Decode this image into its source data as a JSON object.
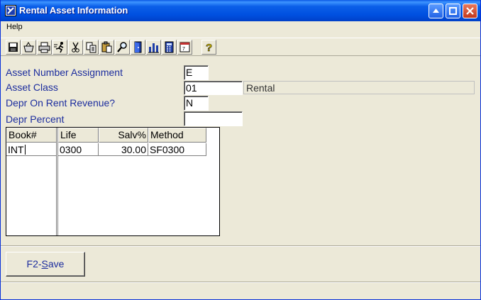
{
  "window": {
    "title": "Rental Asset Information"
  },
  "menu": {
    "help": "Help"
  },
  "toolbar": {
    "icons": [
      "save-icon",
      "basket-icon",
      "print-icon",
      "run-icon",
      "cut-icon",
      "copy-icon",
      "paste-icon",
      "find-icon",
      "exit-door-icon",
      "chart-icon",
      "calculator-icon",
      "calendar-icon",
      "help-icon"
    ]
  },
  "form": {
    "asset_number_label": "Asset Number Assignment",
    "asset_number_value": "E",
    "asset_class_label": "Asset Class",
    "asset_class_value": "01",
    "asset_class_desc": "Rental",
    "depr_rent_label": "Depr On Rent Revenue?",
    "depr_rent_value": "N",
    "depr_percent_label": "Depr Percent",
    "depr_percent_value": ""
  },
  "grid": {
    "columns": [
      "Book#",
      "Life",
      "Salv%",
      "Method"
    ],
    "rows": [
      {
        "book": "INT",
        "life": "0300",
        "salv": "30.00",
        "method": "SF0300"
      }
    ]
  },
  "buttons": {
    "save_prefix": "F2-",
    "save_hotkey": "S",
    "save_rest": "ave"
  },
  "colors": {
    "label": "#1c2d9e",
    "titlebar": "#0050e0",
    "background": "#ece9d8"
  }
}
